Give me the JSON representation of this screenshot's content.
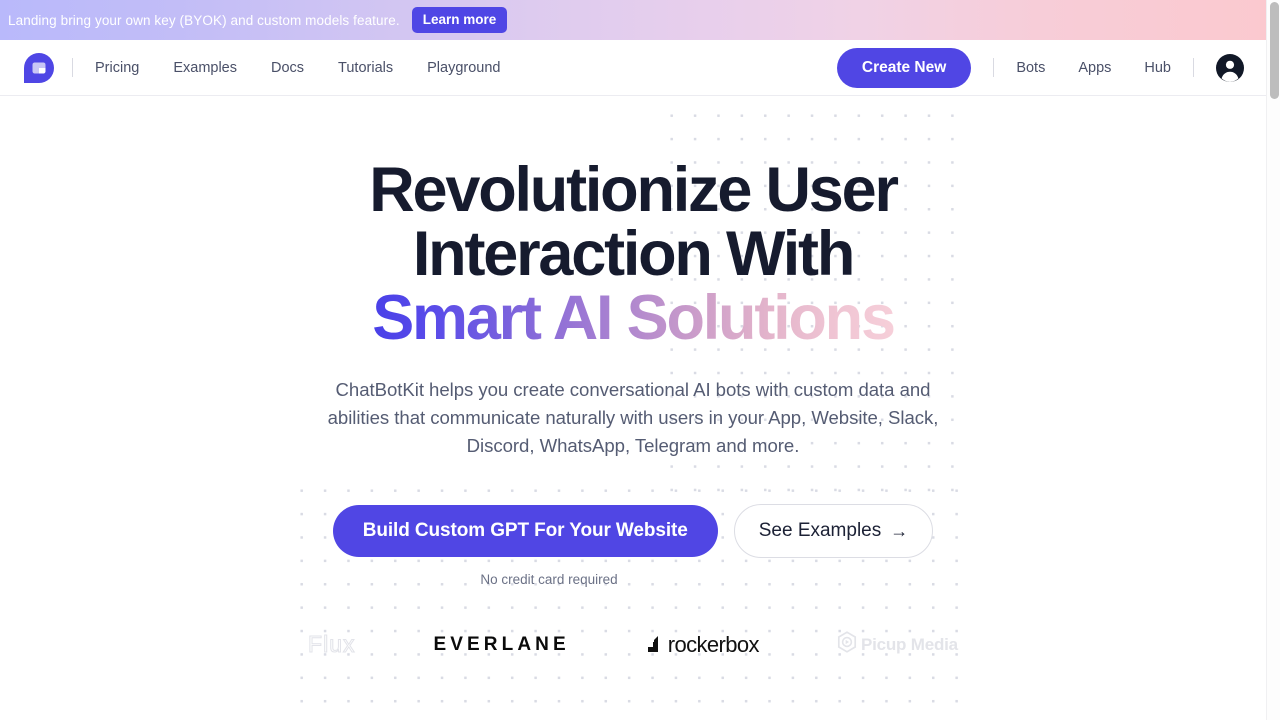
{
  "banner": {
    "text": "Landing bring your own key (BYOK) and custom models feature.",
    "cta_label": "Learn more",
    "gradient_from": "#b9b9fb",
    "gradient_to": "#fbc9cf",
    "cta_color": "#4f46e5"
  },
  "nav": {
    "logo_name": "chatbotkit-logo",
    "links": [
      {
        "label": "Pricing"
      },
      {
        "label": "Examples"
      },
      {
        "label": "Docs"
      },
      {
        "label": "Tutorials"
      },
      {
        "label": "Playground"
      }
    ],
    "create_label": "Create New",
    "right_links": [
      {
        "label": "Bots"
      },
      {
        "label": "Apps"
      },
      {
        "label": "Hub"
      }
    ],
    "avatar_name": "user-avatar-icon",
    "accent": "#5046e4"
  },
  "hero": {
    "headline_line1": "Revolutionize User",
    "headline_line2": "Interaction With",
    "headline_line3_gradient": "Smart AI Solutions",
    "headline_color": "#161b2e",
    "gradient_from": "#4940e8",
    "gradient_to": "#f6cfd9",
    "subhead": "ChatBotKit helps you create conversational AI bots with custom data and abilities that communicate naturally with users in your App, Website, Slack, Discord, WhatsApp, Telegram and more.",
    "primary_cta": "Build Custom GPT For Your Website",
    "secondary_cta": "See Examples",
    "secondary_cta_icon": "arrow-right-icon",
    "credit_note": "No credit card required"
  },
  "brands": [
    {
      "name": "Flux",
      "id": "flux"
    },
    {
      "name": "EVERLANE",
      "id": "everlane"
    },
    {
      "name": "rockerbox",
      "id": "rockerbox"
    },
    {
      "name": "Picup Media",
      "id": "picup-media"
    }
  ],
  "scrollbar": {
    "name": "vertical-scrollbar"
  }
}
